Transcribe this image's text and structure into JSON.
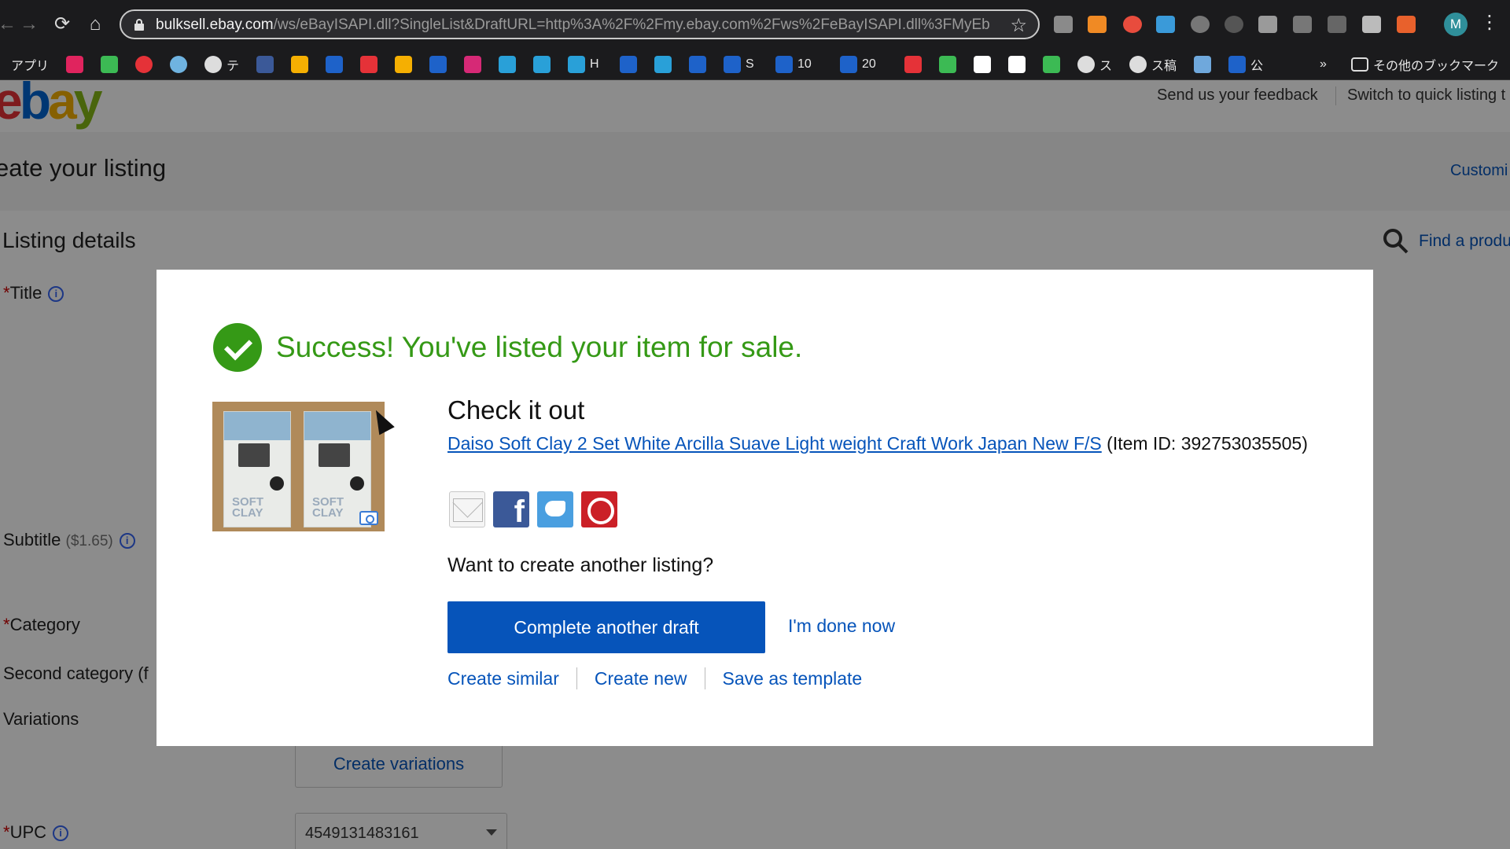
{
  "browser": {
    "url_host": "bulksell.ebay.com",
    "url_rest": "/ws/eBayISAPI.dll?SingleList&DraftURL=http%3A%2F%2Fmy.ebay.com%2Fws%2FeBayISAPI.dll%3FMyEb...",
    "profile_initial": "M",
    "bookmarks": [
      {
        "label": "アプリ",
        "icon": "apps-icon",
        "color": ""
      },
      {
        "label": "",
        "icon": "yahoo-icon",
        "color": "#e0245e"
      },
      {
        "label": "",
        "icon": "message-icon",
        "color": "#3cba54"
      },
      {
        "label": "",
        "icon": "bookmark-red-icon",
        "color": "#e53238"
      },
      {
        "label": "",
        "icon": "globe-icon",
        "color": "#6fb3e0"
      },
      {
        "label": "テ",
        "icon": "globe-icon",
        "color": "#dddddd"
      },
      {
        "label": "",
        "icon": "facebook-icon",
        "color": "#3b5998"
      },
      {
        "label": "",
        "icon": "bookmark-icon",
        "color": "#f5af02"
      },
      {
        "label": "",
        "icon": "paypal-icon",
        "color": "#1e62c9"
      },
      {
        "label": "",
        "icon": "bookmark-icon",
        "color": "#e53238"
      },
      {
        "label": "",
        "icon": "bookmark-icon",
        "color": "#f5af02"
      },
      {
        "label": "",
        "icon": "cw-icon",
        "color": "#1e62c9"
      },
      {
        "label": "",
        "icon": "instagram-icon",
        "color": "#d62976"
      },
      {
        "label": "",
        "icon": "salesforce-icon",
        "color": "#29a0d8"
      },
      {
        "label": "",
        "icon": "salesforce-icon",
        "color": "#29a0d8"
      },
      {
        "label": "H",
        "icon": "salesforce-icon",
        "color": "#29a0d8"
      },
      {
        "label": "",
        "icon": "p-icon",
        "color": "#1e62c9"
      },
      {
        "label": "",
        "icon": "bookmark-icon",
        "color": "#29a0d8"
      },
      {
        "label": "",
        "icon": "calendar-icon",
        "color": "#1e62c9"
      },
      {
        "label": "S",
        "icon": "calendar-icon",
        "color": "#1e62c9"
      },
      {
        "label": "10",
        "icon": "calendar-icon",
        "color": "#1e62c9"
      },
      {
        "label": "20",
        "icon": "calendar-icon",
        "color": "#1e62c9"
      },
      {
        "label": "",
        "icon": "mercari-icon",
        "color": "#e53238"
      },
      {
        "label": "",
        "icon": "sheets-icon",
        "color": "#3cba54"
      },
      {
        "label": "",
        "icon": "amazon-icon",
        "color": "#ffffff"
      },
      {
        "label": "",
        "icon": "amazon-icon",
        "color": "#ffffff"
      },
      {
        "label": "",
        "icon": "bookmark-icon",
        "color": "#3cba54"
      },
      {
        "label": "ス",
        "icon": "globe-icon",
        "color": "#dddddd"
      },
      {
        "label": "ス稿",
        "icon": "globe-icon",
        "color": "#dddddd"
      },
      {
        "label": "",
        "icon": "bookmark-icon",
        "color": "#6fa8dc"
      },
      {
        "label": "公",
        "icon": "bookmark-icon",
        "color": "#1e62c9"
      }
    ],
    "more_bookmarks": "»",
    "other_bookmarks": "その他のブックマーク"
  },
  "page": {
    "feedback_link": "Send us your feedback",
    "quick_listing_link": "Switch to quick listing t",
    "title": "eate your listing",
    "customize_link": "Customi",
    "section_heading": "Listing details",
    "find_product": "Find a produ",
    "fields": {
      "title": "Title",
      "subtitle": "Subtitle",
      "subtitle_fee": "($1.65)",
      "category": "Category",
      "second_category": "Second category (f",
      "variations": "Variations",
      "upc": "UPC"
    },
    "create_variations": "Create variations",
    "upc_value": "4549131483161"
  },
  "modal": {
    "success": "Success! You've listed your item for sale.",
    "check_it_out": "Check it out",
    "item_title": "Daiso Soft Clay 2 Set White Arcilla Suave Light weight Craft Work Japan New F/S",
    "item_id_text": "(Item ID: 392753035505)",
    "photo_box_text": "SOFT CLAY",
    "another_question": "Want to create another listing?",
    "complete_draft": "Complete another draft",
    "done_now": "I'm done now",
    "create_similar": "Create similar",
    "create_new": "Create new",
    "save_template": "Save as template",
    "success_color": "#359916",
    "link_color": "#0654ba"
  }
}
